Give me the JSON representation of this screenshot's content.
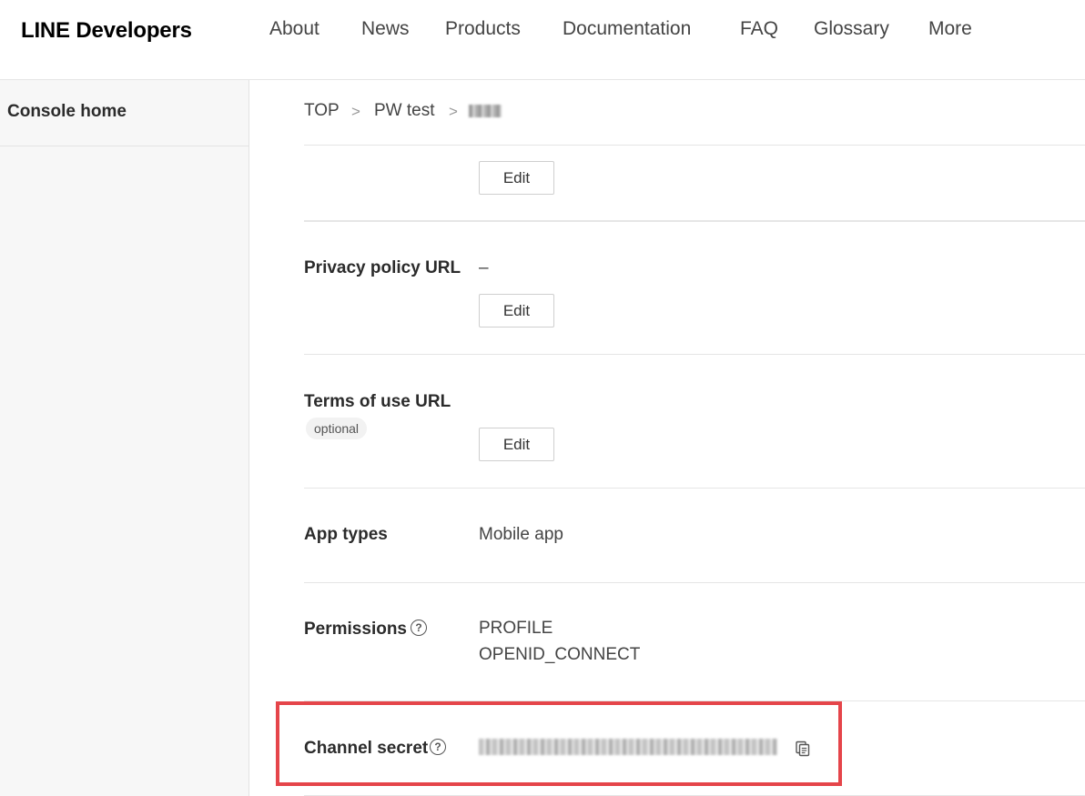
{
  "header": {
    "logo": "LINE Developers",
    "nav": [
      "About",
      "News",
      "Products",
      "Documentation",
      "FAQ",
      "Glossary",
      "More"
    ]
  },
  "sidebar": {
    "console_home": "Console home"
  },
  "breadcrumb": {
    "items": [
      "TOP",
      "PW test"
    ],
    "separator": ">"
  },
  "fields": {
    "edit_label": "Edit",
    "privacy_policy": {
      "label": "Privacy policy URL",
      "value": "–"
    },
    "terms_of_use": {
      "label": "Terms of use URL",
      "badge": "optional"
    },
    "app_types": {
      "label": "App types",
      "value": "Mobile app"
    },
    "permissions": {
      "label": "Permissions",
      "values": [
        "PROFILE",
        "OPENID_CONNECT"
      ]
    },
    "channel_secret": {
      "label": "Channel secret"
    }
  },
  "icons": {
    "help": "help-circle-icon",
    "copy": "copy-icon"
  },
  "colors": {
    "highlight": "#e5454a"
  }
}
